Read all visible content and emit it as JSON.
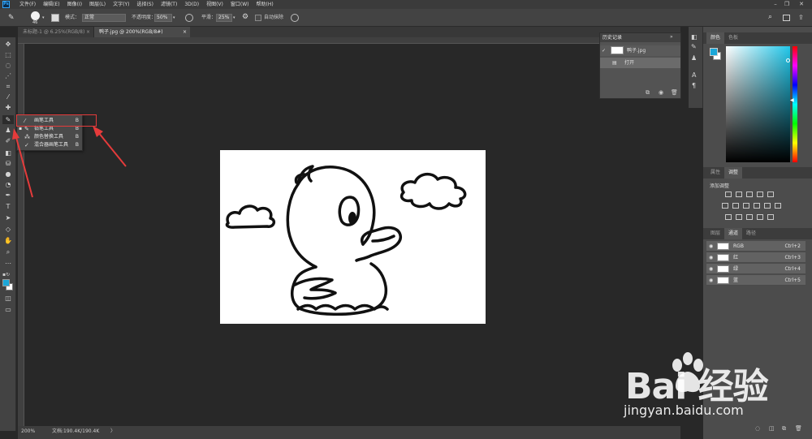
{
  "menubar": {
    "logo": "Ps",
    "items": [
      "文件(F)",
      "编辑(E)",
      "图像(I)",
      "图层(L)",
      "文字(Y)",
      "选择(S)",
      "滤镜(T)",
      "3D(D)",
      "视图(V)",
      "窗口(W)",
      "帮助(H)"
    ],
    "minimize": "–",
    "restore": "❐",
    "close": "✕"
  },
  "options": {
    "brush_size": "46",
    "mode_label": "模式：",
    "mode_value": "正常",
    "opacity_label": "不透明度：",
    "opacity_value": "50%",
    "smooth_label": "平滑：",
    "smooth_value": "25%",
    "auto_erase": "自动抹除"
  },
  "tabs": [
    {
      "label": "未标题-1 @ 6.25%(RGB/8)",
      "close": "×"
    },
    {
      "label": "鸭子.jpg @ 200%(RGB/8#)",
      "close": "×"
    }
  ],
  "flyout": {
    "items": [
      {
        "label": "画笔工具",
        "key": "B"
      },
      {
        "label": "铅笔工具",
        "key": "B"
      },
      {
        "label": "颜色替换工具",
        "key": "B"
      },
      {
        "label": "混合器画笔工具",
        "key": "B"
      }
    ]
  },
  "history": {
    "title": "历史记录",
    "snapshot": "鸭子.jpg",
    "step": "打开"
  },
  "color_panel": {
    "tabs": [
      "颜色",
      "色板"
    ],
    "foreground": "#1ba7d8",
    "background": "#ffffff"
  },
  "adjust_panel": {
    "tabs": [
      "属性",
      "调整"
    ],
    "add_label": "添加调整"
  },
  "channels_panel": {
    "tabs": [
      "图层",
      "通道",
      "路径"
    ],
    "rows": [
      {
        "name": "RGB",
        "key": "Ctrl+2"
      },
      {
        "name": "红",
        "key": "Ctrl+3"
      },
      {
        "name": "绿",
        "key": "Ctrl+4"
      },
      {
        "name": "蓝",
        "key": "Ctrl+5"
      }
    ]
  },
  "status": {
    "zoom": "200%",
    "doc": "文档:190.4K/190.4K",
    "arrow": "〉"
  },
  "watermark": {
    "brand": "Bai  经验",
    "url": "jingyan.baidu.com"
  },
  "colors": {
    "annotation": "#e53b3b"
  }
}
